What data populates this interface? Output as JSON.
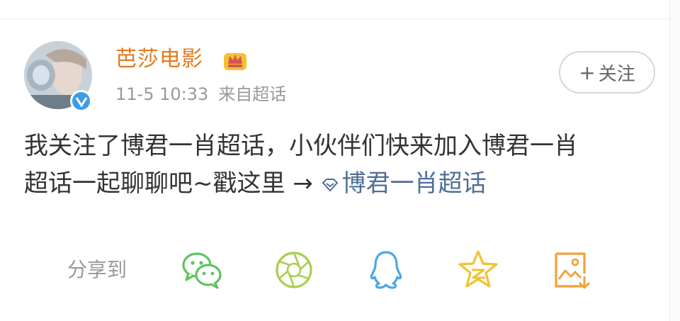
{
  "post": {
    "username": "芭莎电影",
    "time": "11-5 10:33",
    "source": "来自超话",
    "follow_label": "关注",
    "text_line1": "我关注了博君一肖超话，小伙伴们快来加入博君一肖",
    "text_line2_prefix": "超话一起聊聊吧~戳这里 →",
    "topic_link": "博君一肖超话"
  },
  "share": {
    "label": "分享到",
    "targets": [
      "wechat-icon",
      "moments-icon",
      "qq-icon",
      "qzone-icon",
      "save-image-icon"
    ]
  },
  "colors": {
    "username": "#e27b1f",
    "link": "#4f6f96",
    "share_green": "#5ec45f",
    "share_lime": "#a7cf4c",
    "share_blue": "#4aa6e8",
    "share_yellow": "#f1c232",
    "share_orange": "#f0a23a",
    "verified_blue": "#3d9ce6"
  }
}
